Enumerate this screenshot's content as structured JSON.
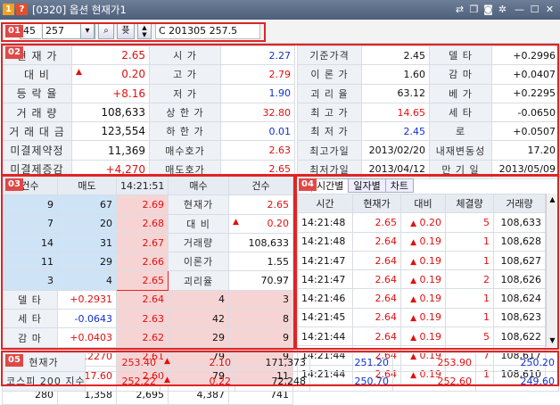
{
  "window": {
    "title": "[0320] 옵션 현재가1",
    "icon1": "1",
    "icon2": "?"
  },
  "badges": [
    "01",
    "02",
    "03",
    "04",
    "05"
  ],
  "toolbar": {
    "prefix": "45",
    "code": "257",
    "btn_label": "퓻",
    "contract": "C 201305 257.5"
  },
  "summary_left": [
    {
      "label": "현 재 가",
      "value": "2.65",
      "color": "red"
    },
    {
      "label": "대 비",
      "value": "0.20",
      "color": "red",
      "arrow": "▲"
    },
    {
      "label": "등 락 율",
      "value": "+8.16",
      "color": "red"
    },
    {
      "label": "거 래 량",
      "value": "108,633",
      "color": ""
    },
    {
      "label": "거 래 대 금",
      "value": "123,554",
      "color": ""
    },
    {
      "label": "미결제약정",
      "value": "11,369",
      "color": ""
    },
    {
      "label": "미결제증감",
      "value": "+4,270",
      "color": "red"
    }
  ],
  "summary_mid": [
    {
      "label": "시 가",
      "value": "2.27",
      "color": "blue"
    },
    {
      "label": "고 가",
      "value": "2.79",
      "color": "red"
    },
    {
      "label": "저 가",
      "value": "1.90",
      "color": "blue"
    },
    {
      "label": "상 한 가",
      "value": "32.80",
      "color": "red"
    },
    {
      "label": "하 한 가",
      "value": "0.01",
      "color": "blue"
    },
    {
      "label": "매수호가",
      "value": "2.63",
      "color": "red"
    },
    {
      "label": "매도호가",
      "value": "2.65",
      "color": "red"
    }
  ],
  "summary_right1": [
    {
      "label": "기준가격",
      "value": "2.45",
      "color": ""
    },
    {
      "label": "이 론 가",
      "value": "1.60",
      "color": ""
    },
    {
      "label": "괴 리 율",
      "value": "63.12",
      "color": ""
    },
    {
      "label": "최 고 가",
      "value": "14.65",
      "color": "red"
    },
    {
      "label": "최 저 가",
      "value": "2.45",
      "color": "blue"
    },
    {
      "label": "최고가일",
      "value": "2013/02/20",
      "color": ""
    },
    {
      "label": "최저가일",
      "value": "2013/04/12",
      "color": ""
    }
  ],
  "summary_right2": [
    {
      "label": "델 타",
      "value": "+0.2996",
      "color": ""
    },
    {
      "label": "감 마",
      "value": "+0.0407",
      "color": ""
    },
    {
      "label": "베 가",
      "value": "+0.2295",
      "color": ""
    },
    {
      "label": "세 타",
      "value": "-0.0650",
      "color": ""
    },
    {
      "label": "로",
      "value": "+0.0507",
      "color": ""
    },
    {
      "label": "내재변동성",
      "value": "17.20",
      "color": ""
    },
    {
      "label": "만 기 일",
      "value": "2013/05/09",
      "color": ""
    }
  ],
  "orderbook": {
    "headers": {
      "count": "건수",
      "ask": "매도",
      "time": "14:21:51",
      "bid": "매수",
      "count2": "건수"
    },
    "asks": [
      {
        "cnt": "9",
        "qty": "67",
        "price": "2.69"
      },
      {
        "cnt": "7",
        "qty": "20",
        "price": "2.68"
      },
      {
        "cnt": "14",
        "qty": "31",
        "price": "2.67"
      },
      {
        "cnt": "11",
        "qty": "29",
        "price": "2.66"
      },
      {
        "cnt": "3",
        "qty": "4",
        "price": "2.65"
      }
    ],
    "bids": [
      {
        "price": "2.64",
        "qty": "4",
        "cnt": "3"
      },
      {
        "price": "2.63",
        "qty": "42",
        "cnt": "8"
      },
      {
        "price": "2.62",
        "qty": "29",
        "cnt": "9"
      },
      {
        "price": "2.61",
        "qty": "79",
        "cnt": "9"
      },
      {
        "price": "2.60",
        "qty": "79",
        "cnt": "11"
      }
    ],
    "side_info": [
      {
        "label": "현재가",
        "value": "2.65",
        "color": "red",
        "arrow": ""
      },
      {
        "label": "대 비",
        "value": "0.20",
        "color": "red",
        "arrow": "▲"
      },
      {
        "label": "거래량",
        "value": "108,633",
        "color": "",
        "arrow": ""
      },
      {
        "label": "이론가",
        "value": "1.55",
        "color": "",
        "arrow": ""
      },
      {
        "label": "괴리율",
        "value": "70.97",
        "color": "",
        "arrow": ""
      }
    ],
    "greeks": [
      {
        "label": "델 타",
        "value": "+0.2931",
        "color": "red"
      },
      {
        "label": "세 타",
        "value": "-0.0643",
        "color": "blue"
      },
      {
        "label": "감 마",
        "value": "+0.0403",
        "color": "red"
      },
      {
        "label": "베 가",
        "value": "+0.2270",
        "color": "red"
      },
      {
        "label": "I . V",
        "value": "17.60",
        "color": "red"
      }
    ],
    "totals": {
      "ask_cnt": "280",
      "ask_qty": "1,358",
      "diff": "2,695",
      "bid_qty": "4,387",
      "bid_cnt": "741"
    }
  },
  "trades": {
    "tabs": [
      "시간별",
      "일자별",
      "차트"
    ],
    "headers": [
      "시간",
      "현재가",
      "대비",
      "체결량",
      "거래량"
    ],
    "rows": [
      {
        "time": "14:21:48",
        "price": "2.65",
        "diff": "0.20",
        "vol": "5",
        "cum": "108,633"
      },
      {
        "time": "14:21:48",
        "price": "2.64",
        "diff": "0.19",
        "vol": "1",
        "cum": "108,628"
      },
      {
        "time": "14:21:47",
        "price": "2.64",
        "diff": "0.19",
        "vol": "1",
        "cum": "108,627"
      },
      {
        "time": "14:21:47",
        "price": "2.64",
        "diff": "0.19",
        "vol": "2",
        "cum": "108,626"
      },
      {
        "time": "14:21:46",
        "price": "2.64",
        "diff": "0.19",
        "vol": "1",
        "cum": "108,624"
      },
      {
        "time": "14:21:45",
        "price": "2.64",
        "diff": "0.19",
        "vol": "1",
        "cum": "108,623"
      },
      {
        "time": "14:21:44",
        "price": "2.64",
        "diff": "0.19",
        "vol": "5",
        "cum": "108,622"
      },
      {
        "time": "14:21:44",
        "price": "2.64",
        "diff": "0.19",
        "vol": "7",
        "cum": "108,617"
      },
      {
        "time": "14:21:44",
        "price": "2.64",
        "diff": "0.19",
        "vol": "1",
        "cum": "108,610"
      }
    ]
  },
  "bottom": [
    {
      "name": "현재가",
      "price": "253.40",
      "diff": "2.10",
      "vol": "171,373",
      "a": "251.20",
      "b": "253.90",
      "c": "250.20"
    },
    {
      "name": "코스피 200 지수",
      "price": "252.22",
      "diff": "0.22",
      "vol": "72,248",
      "a": "250.70",
      "b": "252.60",
      "c": "249.60"
    }
  ]
}
